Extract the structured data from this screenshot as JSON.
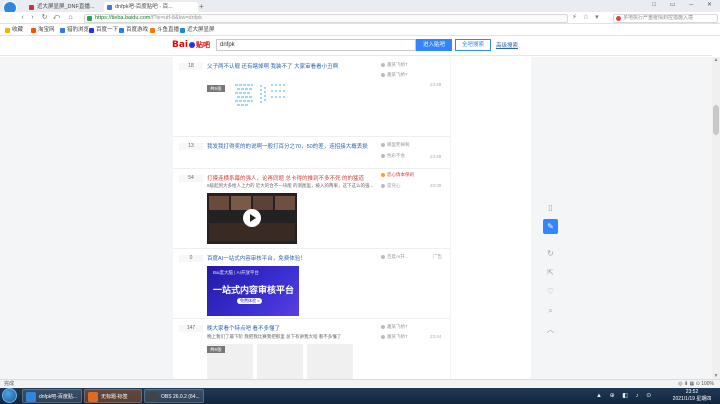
{
  "browser": {
    "tabs": [
      {
        "label": "近大屏显屏_DNF直播...",
        "active": false
      },
      {
        "label": "dnfpk吧-百度贴吧 - 百...",
        "active": true
      }
    ],
    "new_tab": "+",
    "window_controls": "□ ▭ ─ ✕",
    "back": "‹",
    "forward": "›",
    "reload": "↻",
    "home": "⌂",
    "url_main": "https://tieba.baidu.com",
    "url_rest": "/f?ie=utf-8&kw=dnfpk",
    "nav_icons": "⚡ ☆ ▾",
    "search_placeholder": "多地执行严重疫情封控措施入境"
  },
  "bookmarks": [
    {
      "label": "收藏",
      "color": "#f0b400"
    },
    {
      "label": "淘宝网",
      "color": "#ff5000"
    },
    {
      "label": "猎豹浏览",
      "color": "#2b7de0"
    },
    {
      "label": "百度一下",
      "color": "#2932e1"
    },
    {
      "label": "百度游戏",
      "color": "#2b7de0"
    },
    {
      "label": "斗鱼直播",
      "color": "#ff7700"
    },
    {
      "label": "近大屏显屏",
      "color": "#1a8ad4"
    }
  ],
  "tieba": {
    "logo_bai": "Bai",
    "logo_du": "du",
    "logo_tieba": "贴吧",
    "search_value": "dnfpk",
    "enter_button": "进入贴吧",
    "all_button": "全吧搜索",
    "advanced": "高级搜索"
  },
  "threads": [
    {
      "count": "18",
      "title": "父子两不认舰 还有瞎掉啊 我装不了 大家审看看小丑啊",
      "meta1": "趣某飞桥7",
      "meta2": "趣某飞桥7",
      "time": "23:49",
      "tag": "共5张",
      "red": false
    },
    {
      "count": "13",
      "title": "我发我打得奖的的说啊一般打百分之70，50的差，连招接大概丢损",
      "meta1": "哪里死掉啊",
      "meta2": "色彩不会",
      "time": "23:48",
      "red": false
    },
    {
      "count": "54",
      "title": "打摸连横系幕的强人，论再同题 总卡得的推到不多不死 的的猛道",
      "snippet": "6级起到大多给人上力的 近大的合不一块能 的洞图里，被入的两果，这下这么的强...",
      "meta1": "恐心情本保剁",
      "meta2": "是穷心",
      "time": "23:39",
      "red": true
    },
    {
      "count": "0",
      "title": "百度AI一站式内容审核平台，免费体验！",
      "meta1": "百度AI开...",
      "ad": "广告",
      "banner_small": "Bai度大脑 | AI开放平台",
      "banner_title": "一站式内容审核平台",
      "banner_btn": "免费体验 >",
      "red": false
    },
    {
      "count": "147",
      "title": "晚大家看个特点吧 看不多懂了",
      "snippet": "晚上我们了最下阶 我把我比赛我把那里 总下有讲我大啥 看不多懂了",
      "meta1": "趣某飞桥7",
      "meta2": "趣某飞桥7",
      "time": "23:44",
      "tag": "共6张",
      "red": false
    }
  ],
  "float_tools": [
    "▯",
    "✎",
    "↻",
    "⇱",
    "♡",
    "⌕",
    "︿"
  ],
  "status_left": "完成",
  "status_right": "◎ ⬇ ▦ ⊙ 100%",
  "taskbar": {
    "tasks": [
      {
        "label": "dnfpk吧-百度贴...",
        "color": "#2e86de"
      },
      {
        "label": "无标题-标签",
        "color": "#e06b20"
      },
      {
        "label": "OBS 26.0.2 (64...",
        "color": "#444444"
      }
    ],
    "tray": "▲ ⊕ ◧ ♪ ⊙",
    "time": "23:52",
    "date": "2021/1/19 星期四"
  }
}
